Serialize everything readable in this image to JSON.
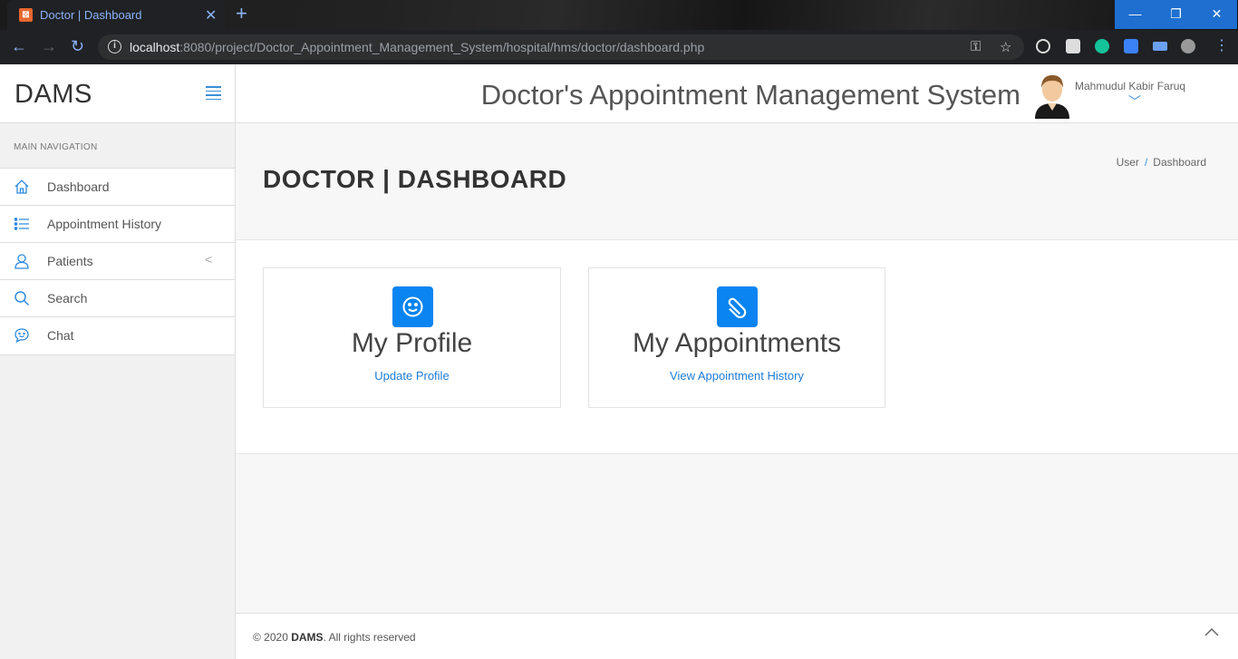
{
  "browser": {
    "tab_title": "Doctor | Dashboard",
    "url_host": "localhost",
    "url_rest": ":8080/project/Doctor_Appointment_Management_System/hospital/hms/doctor/dashboard.php"
  },
  "brand": {
    "name": "DAMS"
  },
  "sidebar": {
    "heading": "MAIN NAVIGATION",
    "items": [
      {
        "label": "Dashboard",
        "icon": "home-icon"
      },
      {
        "label": "Appointment History",
        "icon": "list-icon"
      },
      {
        "label": "Patients",
        "icon": "user-icon"
      },
      {
        "label": "Search",
        "icon": "search-icon"
      },
      {
        "label": "Chat",
        "icon": "chat-icon"
      }
    ]
  },
  "header": {
    "system_title": "Doctor's Appointment Management System",
    "user_name": "Mahmudul Kabir Faruq"
  },
  "page": {
    "title": "DOCTOR | DASHBOARD",
    "breadcrumb": [
      "User",
      "Dashboard"
    ]
  },
  "cards": [
    {
      "title": "My Profile",
      "link": "Update Profile",
      "icon": "smile-icon"
    },
    {
      "title": "My Appointments",
      "link": "View Appointment History",
      "icon": "paperclip-icon"
    }
  ],
  "footer": {
    "prefix": "© 2020 ",
    "brand": "DAMS",
    "suffix": ". All rights reserved"
  },
  "colors": {
    "accent": "#0a84f0",
    "link": "#1e7bd4"
  }
}
